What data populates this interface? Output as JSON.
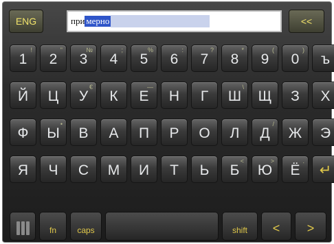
{
  "topbar": {
    "lang_label": "ENG",
    "typed_text": "при",
    "selected_text": "мерно",
    "backspace_label": "<<"
  },
  "rows": [
    [
      {
        "label": "1",
        "sub": "!"
      },
      {
        "label": "2",
        "sub": "\""
      },
      {
        "label": "3",
        "sub": "№"
      },
      {
        "label": "4",
        "sub": ";"
      },
      {
        "label": "5",
        "sub": "%"
      },
      {
        "label": "6",
        "sub": ":"
      },
      {
        "label": "7",
        "sub": "?"
      },
      {
        "label": "8",
        "sub": "*"
      },
      {
        "label": "9",
        "sub": "("
      },
      {
        "label": "0",
        "sub": ")"
      },
      {
        "label": "ъ",
        "sub": ""
      }
    ],
    [
      {
        "label": "Й",
        "sub": ""
      },
      {
        "label": "Ц",
        "sub": ""
      },
      {
        "label": "У",
        "sub": "€"
      },
      {
        "label": "К",
        "sub": ""
      },
      {
        "label": "Е",
        "sub": "—"
      },
      {
        "label": "Н",
        "sub": ""
      },
      {
        "label": "Г",
        "sub": ""
      },
      {
        "label": "Ш",
        "sub": "\\"
      },
      {
        "label": "Щ",
        "sub": ""
      },
      {
        "label": "З",
        "sub": ""
      },
      {
        "label": "Х",
        "sub": ""
      }
    ],
    [
      {
        "label": "Ф",
        "sub": ""
      },
      {
        "label": "Ы",
        "sub": "•"
      },
      {
        "label": "В",
        "sub": ""
      },
      {
        "label": "А",
        "sub": ""
      },
      {
        "label": "П",
        "sub": ""
      },
      {
        "label": "Р",
        "sub": ""
      },
      {
        "label": "О",
        "sub": ""
      },
      {
        "label": "Л",
        "sub": ""
      },
      {
        "label": "Д",
        "sub": "/"
      },
      {
        "label": "Ж",
        "sub": ""
      },
      {
        "label": "Э",
        "sub": ""
      }
    ],
    [
      {
        "label": "Я",
        "sub": ""
      },
      {
        "label": "Ч",
        "sub": ""
      },
      {
        "label": "С",
        "sub": ""
      },
      {
        "label": "М",
        "sub": ""
      },
      {
        "label": "И",
        "sub": ""
      },
      {
        "label": "Т",
        "sub": ""
      },
      {
        "label": "Ь",
        "sub": ""
      },
      {
        "label": "Б",
        "sub": "<"
      },
      {
        "label": "Ю",
        "sub": ">"
      },
      {
        "label": "Ё",
        "sub": "."
      },
      {
        "label": "↵",
        "sub": "",
        "enter": true
      }
    ]
  ],
  "bottom": {
    "fn_label": "fn",
    "caps_label": "caps",
    "space_label": "",
    "shift_label": "shift",
    "left_arrow": "<",
    "right_arrow": ">"
  }
}
